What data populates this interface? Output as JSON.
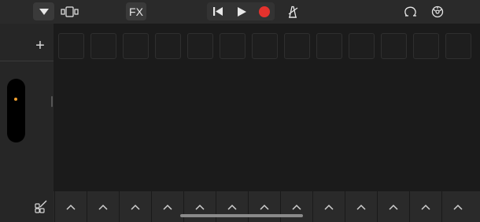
{
  "toolbar": {
    "fx_label": "FX",
    "icons": {
      "menu": "triangle-down-icon",
      "view": "view-toggle-icon",
      "go_to_start": "skip-back-icon",
      "play": "play-icon",
      "record": "record-icon",
      "metronome": "metronome-icon",
      "loop": "loop-icon",
      "settings": "settings-icon"
    },
    "record_color": "#e5322d"
  },
  "sidebar": {
    "add_label": "+",
    "slider_indicator_color": "#f0a030"
  },
  "grid": {
    "columns": 13
  },
  "bottom": {
    "column_arrows": 13,
    "icons": {
      "edit": "edit-grid-icon",
      "expand": "chevron-up-icon"
    }
  }
}
